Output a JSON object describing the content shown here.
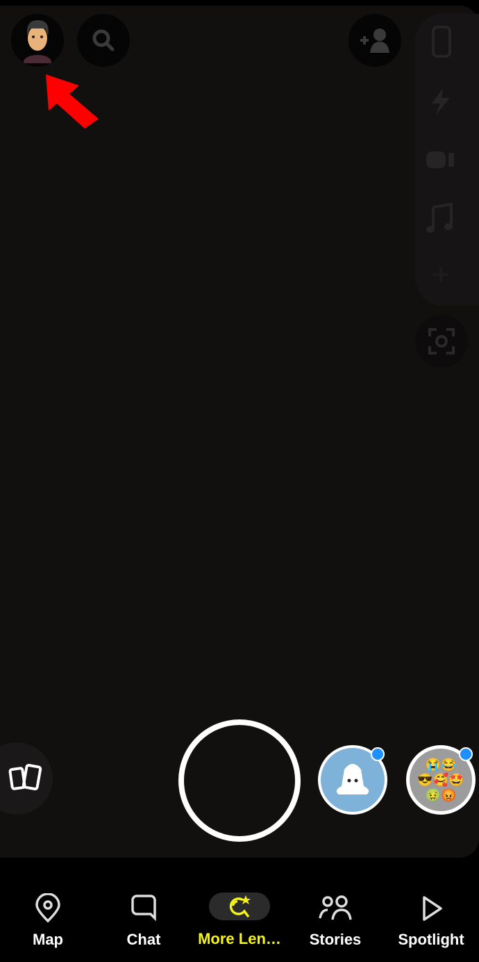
{
  "nav": {
    "items": [
      {
        "label": "Map",
        "icon": "map-pin-icon"
      },
      {
        "label": "Chat",
        "icon": "chat-bubble-icon"
      },
      {
        "label": "More Len…",
        "icon": "lens-explore-icon",
        "active": true
      },
      {
        "label": "Stories",
        "icon": "people-icon"
      },
      {
        "label": "Spotlight",
        "icon": "play-icon"
      }
    ]
  },
  "colors": {
    "active": "#f5f518",
    "annotation_arrow": "#ff0000",
    "badge": "#1e8fff"
  }
}
